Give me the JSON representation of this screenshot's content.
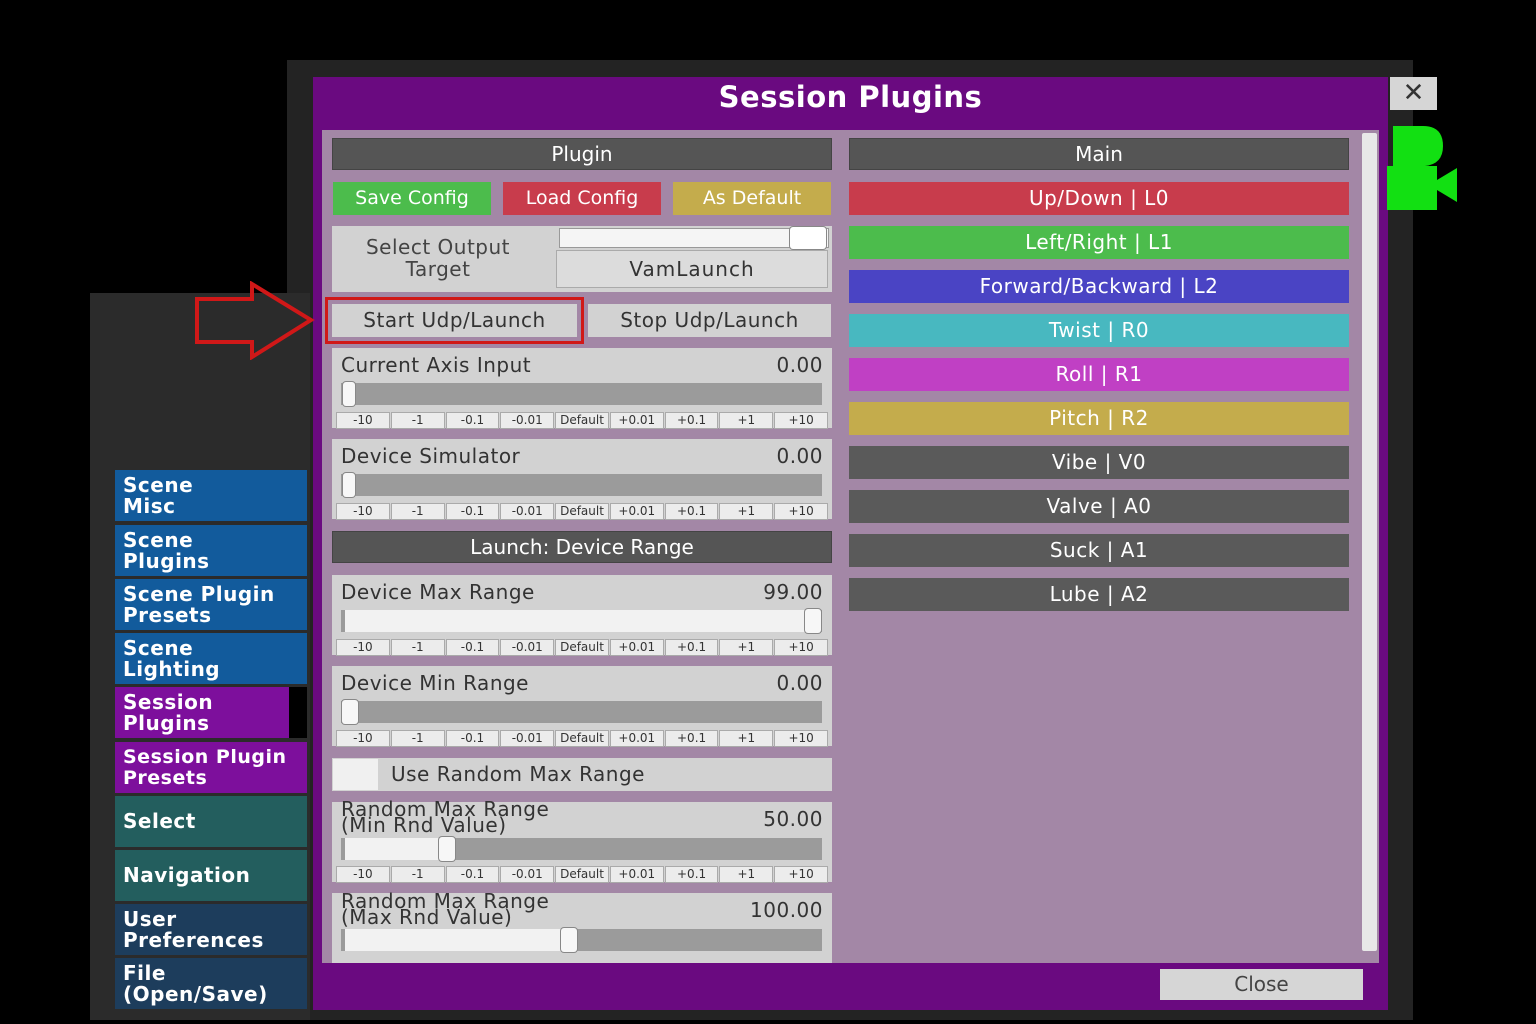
{
  "dialog": {
    "title": "Session Plugins",
    "close_x": "✕",
    "close_label": "Close"
  },
  "left_menu": [
    {
      "label": "Scene\nMisc"
    },
    {
      "label": "Scene\nPlugins"
    },
    {
      "label": "Scene Plugin\nPresets"
    },
    {
      "label": "Scene\nLighting"
    },
    {
      "label": "Session\nPlugins"
    },
    {
      "label": "Session Plugin\nPresets"
    },
    {
      "label": "Select"
    },
    {
      "label": "Navigation"
    },
    {
      "label": "User\nPreferences"
    },
    {
      "label": "File\n(Open/Save)"
    }
  ],
  "plugin": {
    "header": "Plugin",
    "save_config": "Save Config",
    "load_config": "Load Config",
    "as_default": "As Default",
    "select_output_label": "Select Output\nTarget",
    "select_output_value": "VamLaunch",
    "start_udp": "Start Udp/Launch",
    "stop_udp": "Stop Udp/Launch",
    "launch_range_header": "Launch: Device Range",
    "use_random_label": "Use Random Max Range"
  },
  "step_labels": [
    "-10",
    "-1",
    "-0.1",
    "-0.01",
    "Default",
    "+0.01",
    "+0.1",
    "+1",
    "+10"
  ],
  "sliders": {
    "current_axis": {
      "label": "Current Axis Input",
      "value": "0.00",
      "fraction": 0.0
    },
    "device_sim": {
      "label": "Device Simulator",
      "value": "0.00",
      "fraction": 0.0
    },
    "device_max": {
      "label": "Device Max Range",
      "value": "99.00",
      "fraction": 0.99
    },
    "device_min": {
      "label": "Device Min Range",
      "value": "0.00",
      "fraction": 0.0
    },
    "random_min": {
      "label": "Random Max Range\n(Min Rnd Value)",
      "value": "50.00",
      "fraction": 0.22
    },
    "random_max": {
      "label": "Random Max Range\n(Max Rnd Value)",
      "value": "100.00",
      "fraction": 0.48
    }
  },
  "main": {
    "header": "Main",
    "axes": [
      {
        "label": "Up/Down | L0",
        "color": "#c83c4c"
      },
      {
        "label": "Left/Right | L1",
        "color": "#4cbc4c"
      },
      {
        "label": "Forward/Backward | L2",
        "color": "#4a44c4"
      },
      {
        "label": "Twist | R0",
        "color": "#48b8c0"
      },
      {
        "label": "Roll | R1",
        "color": "#c040c4"
      },
      {
        "label": "Pitch | R2",
        "color": "#c4ac4c"
      },
      {
        "label": "Vibe | V0",
        "color": "#5a5a5a"
      },
      {
        "label": "Valve | A0",
        "color": "#5a5a5a"
      },
      {
        "label": "Suck | A1",
        "color": "#5a5a5a"
      },
      {
        "label": "Lube | A2",
        "color": "#5a5a5a"
      }
    ]
  },
  "colors": {
    "save": "#4cbc4c",
    "load": "#c83c4c",
    "default": "#c4ac4c",
    "camera": "#12e012",
    "highlight": "#d01818"
  },
  "icons": {
    "camera": "camera-icon",
    "arrow": "arrow-right-icon"
  }
}
